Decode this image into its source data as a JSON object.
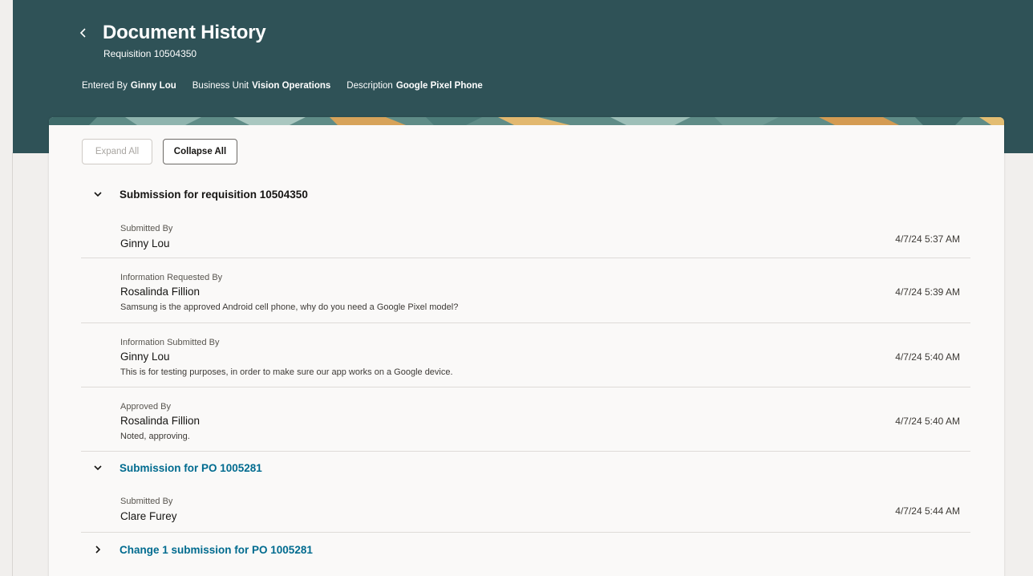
{
  "header": {
    "back_icon": "chevron-left-icon",
    "title": "Document History",
    "subtitle": "Requisition 10504350",
    "meta": [
      {
        "label": "Entered By",
        "value": "Ginny Lou"
      },
      {
        "label": "Business Unit",
        "value": "Vision Operations"
      },
      {
        "label": "Description",
        "value": "Google Pixel Phone"
      }
    ],
    "colors": {
      "background": "#2f5257",
      "text": "#ffffff"
    }
  },
  "toolbar": {
    "expand_all": "Expand All",
    "collapse_all": "Collapse All"
  },
  "sections": [
    {
      "title": "Submission for requisition 10504350",
      "state": "expanded",
      "entries": [
        {
          "label": "Submitted By",
          "name": "Ginny Lou",
          "comment": "",
          "time": "4/7/24 5:37 AM"
        },
        {
          "label": "Information Requested By",
          "name": "Rosalinda Fillion",
          "comment": "Samsung is the approved Android cell phone, why do you need a Google Pixel model?",
          "time": "4/7/24 5:39 AM"
        },
        {
          "label": "Information Submitted By",
          "name": "Ginny Lou",
          "comment": "This is for testing purposes, in order to make sure our app works on a Google device.",
          "time": "4/7/24 5:40 AM"
        },
        {
          "label": "Approved By",
          "name": "Rosalinda Fillion",
          "comment": "Noted, approving.",
          "time": "4/7/24 5:40 AM"
        }
      ]
    },
    {
      "title": "Submission for PO 1005281",
      "state": "expanded",
      "entries": [
        {
          "label": "Submitted By",
          "name": "Clare Furey",
          "comment": "",
          "time": "4/7/24 5:44 AM"
        }
      ]
    },
    {
      "title": "Change 1 submission for PO 1005281",
      "state": "collapsed",
      "entries": []
    }
  ],
  "colors": {
    "link": "#006b8f",
    "page_bg": "#f1efed",
    "card_bg": "#faf9f8"
  }
}
